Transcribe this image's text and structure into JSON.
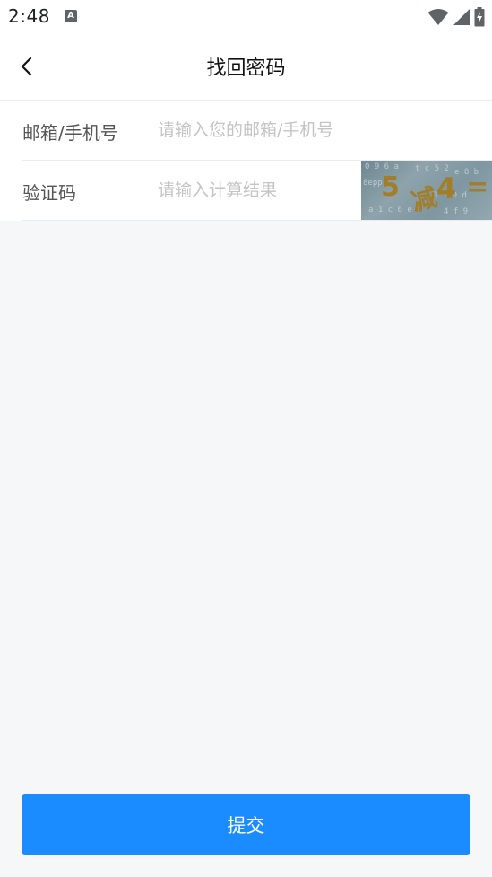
{
  "status_bar": {
    "time": "2:48",
    "notification_icon": "A"
  },
  "header": {
    "title": "找回密码",
    "back_icon": "chevron-left-icon"
  },
  "form": {
    "email": {
      "label": "邮箱/手机号",
      "placeholder": "请输入您的邮箱/手机号",
      "value": ""
    },
    "captcha": {
      "label": "验证码",
      "placeholder": "请输入计算结果",
      "value": "",
      "image_text": [
        "5",
        "减",
        "4",
        "="
      ]
    }
  },
  "submit": {
    "label": "提交"
  },
  "colors": {
    "primary": "#1a8cff",
    "background": "#f6f7f9",
    "captcha_text": "#a27e2a"
  }
}
